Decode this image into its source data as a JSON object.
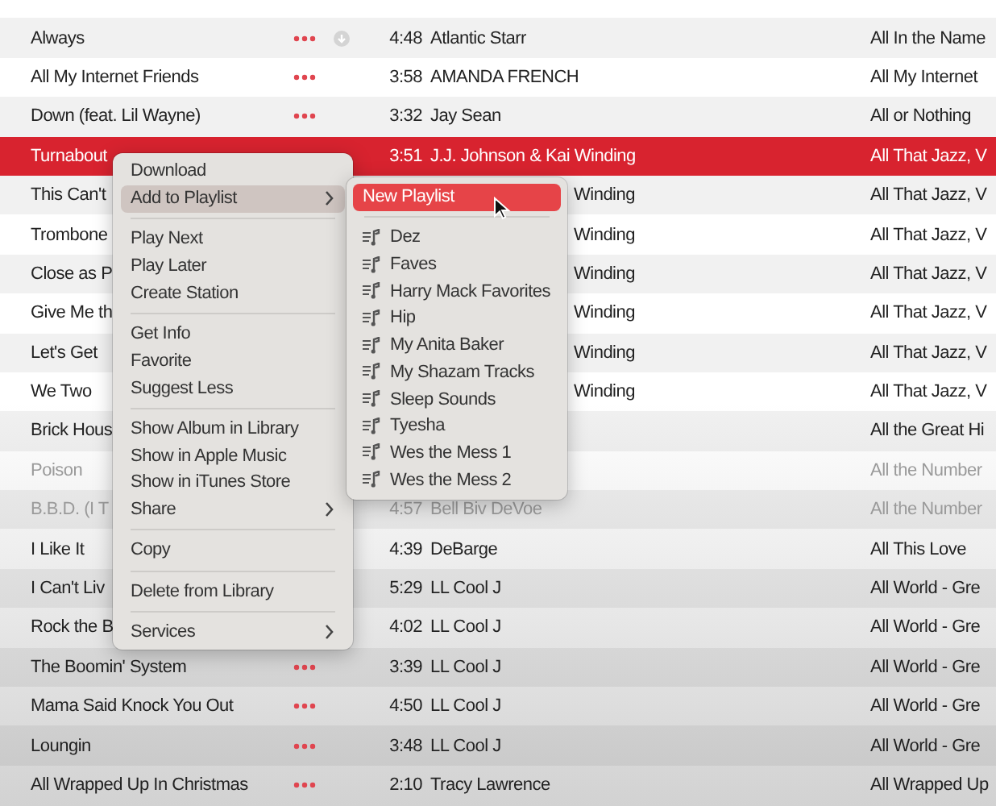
{
  "tracks": [
    {
      "title": "Always",
      "more": true,
      "cloud": true,
      "time": "4:48",
      "artist": "Atlantic Starr",
      "album": "All In the Name",
      "selected": false,
      "greyed": false
    },
    {
      "title": "All My Internet Friends",
      "more": true,
      "time": "3:58",
      "artist": "AMANDA FRENCH",
      "album": "All My Internet",
      "selected": false,
      "greyed": false
    },
    {
      "title": "Down (feat. Lil Wayne)",
      "more": true,
      "time": "3:32",
      "artist": "Jay Sean",
      "album": "All or Nothing",
      "selected": false,
      "greyed": false
    },
    {
      "title": "Turnabout",
      "time": "3:51",
      "artist": "J.J. Johnson & Kai Winding",
      "album": "All That Jazz, V",
      "selected": true,
      "greyed": false
    },
    {
      "title": "This Can't",
      "artist": "Winding",
      "artist_cut": true,
      "album": "All That Jazz, V",
      "selected": false,
      "greyed": false
    },
    {
      "title": "Trombone",
      "artist": "Winding",
      "artist_cut": true,
      "album": "All That Jazz, V",
      "selected": false,
      "greyed": false
    },
    {
      "title": "Close as P",
      "artist": "Winding",
      "artist_cut": true,
      "album": "All That Jazz, V",
      "selected": false,
      "greyed": false
    },
    {
      "title": "Give Me th",
      "artist": "Winding",
      "artist_cut": true,
      "album": "All That Jazz, V",
      "selected": false,
      "greyed": false
    },
    {
      "title": "Let's Get",
      "artist": "Winding",
      "artist_cut": true,
      "album": "All That Jazz, V",
      "selected": false,
      "greyed": false
    },
    {
      "title": "We Two",
      "artist": "Winding",
      "artist_cut": true,
      "album": "All That Jazz, V",
      "selected": false,
      "greyed": false
    },
    {
      "title": "Brick Hous",
      "album": "All the Great Hi",
      "selected": false,
      "greyed": false
    },
    {
      "title": "Poison",
      "album": "All the Number",
      "selected": false,
      "greyed": true
    },
    {
      "title": "B.B.D. (I T",
      "time": "4:57",
      "artist": "Bell Biv DeVoe",
      "album": "All the Number",
      "selected": false,
      "greyed": true
    },
    {
      "title": "I Like It",
      "time": "4:39",
      "artist": "DeBarge",
      "album": "All This Love",
      "selected": false,
      "greyed": false
    },
    {
      "title": "I Can't Liv",
      "time": "5:29",
      "artist": "LL Cool J",
      "album": "All World - Gre",
      "selected": false,
      "greyed": false
    },
    {
      "title": "Rock the B",
      "time": "4:02",
      "artist": "LL Cool J",
      "album": "All World - Gre",
      "selected": false,
      "greyed": false
    },
    {
      "title": "The Boomin' System",
      "more": true,
      "time": "3:39",
      "artist": "LL Cool J",
      "album": "All World - Gre",
      "selected": false,
      "greyed": false
    },
    {
      "title": "Mama Said Knock You Out",
      "more": true,
      "time": "4:50",
      "artist": "LL Cool J",
      "album": "All World - Gre",
      "selected": false,
      "greyed": false
    },
    {
      "title": "Loungin",
      "more": true,
      "time": "3:48",
      "artist": "LL Cool J",
      "album": "All World - Gre",
      "selected": false,
      "greyed": false
    },
    {
      "title": "All Wrapped Up In Christmas",
      "more": true,
      "time": "2:10",
      "artist": "Tracy Lawrence",
      "album": "All Wrapped Up",
      "selected": false,
      "greyed": false
    }
  ],
  "context_menu": {
    "items": [
      {
        "kind": "item",
        "label": "Download",
        "submenu": false,
        "selected": false
      },
      {
        "kind": "item",
        "label": "Add to Playlist",
        "submenu": true,
        "selected": true
      },
      {
        "kind": "separator"
      },
      {
        "kind": "item",
        "label": "Play Next",
        "submenu": false,
        "selected": false
      },
      {
        "kind": "item",
        "label": "Play Later",
        "submenu": false,
        "selected": false
      },
      {
        "kind": "item",
        "label": "Create Station",
        "submenu": false,
        "selected": false
      },
      {
        "kind": "separator"
      },
      {
        "kind": "item",
        "label": "Get Info",
        "submenu": false,
        "selected": false
      },
      {
        "kind": "item",
        "label": "Favorite",
        "submenu": false,
        "selected": false
      },
      {
        "kind": "item",
        "label": "Suggest Less",
        "submenu": false,
        "selected": false
      },
      {
        "kind": "separator"
      },
      {
        "kind": "item",
        "label": "Show Album in Library",
        "submenu": false,
        "selected": false
      },
      {
        "kind": "item",
        "label": "Show in Apple Music",
        "submenu": false,
        "selected": false
      },
      {
        "kind": "item",
        "label": "Show in iTunes Store",
        "submenu": false,
        "selected": false
      },
      {
        "kind": "item",
        "label": "Share",
        "submenu": true,
        "selected": false
      },
      {
        "kind": "separator"
      },
      {
        "kind": "item",
        "label": "Copy",
        "submenu": false,
        "selected": false
      },
      {
        "kind": "separator"
      },
      {
        "kind": "item",
        "label": "Delete from Library",
        "submenu": false,
        "selected": false
      },
      {
        "kind": "separator"
      },
      {
        "kind": "item",
        "label": "Services",
        "submenu": true,
        "selected": false
      }
    ]
  },
  "playlist_submenu": {
    "items": [
      {
        "kind": "action",
        "label": "New Playlist",
        "selected": true
      },
      {
        "kind": "separator"
      },
      {
        "kind": "playlist",
        "label": "Dez",
        "selected": false
      },
      {
        "kind": "playlist",
        "label": "Faves",
        "selected": false
      },
      {
        "kind": "playlist",
        "label": "Harry Mack Favorites",
        "selected": false
      },
      {
        "kind": "playlist",
        "label": "Hip",
        "selected": false
      },
      {
        "kind": "playlist",
        "label": "My Anita Baker",
        "selected": false
      },
      {
        "kind": "playlist",
        "label": "My Shazam Tracks",
        "selected": false
      },
      {
        "kind": "playlist",
        "label": "Sleep Sounds",
        "selected": false
      },
      {
        "kind": "playlist",
        "label": "Tyesha",
        "selected": false
      },
      {
        "kind": "playlist",
        "label": "Wes the Mess 1",
        "selected": false
      },
      {
        "kind": "playlist",
        "label": "Wes the Mess 2",
        "selected": false
      }
    ]
  }
}
